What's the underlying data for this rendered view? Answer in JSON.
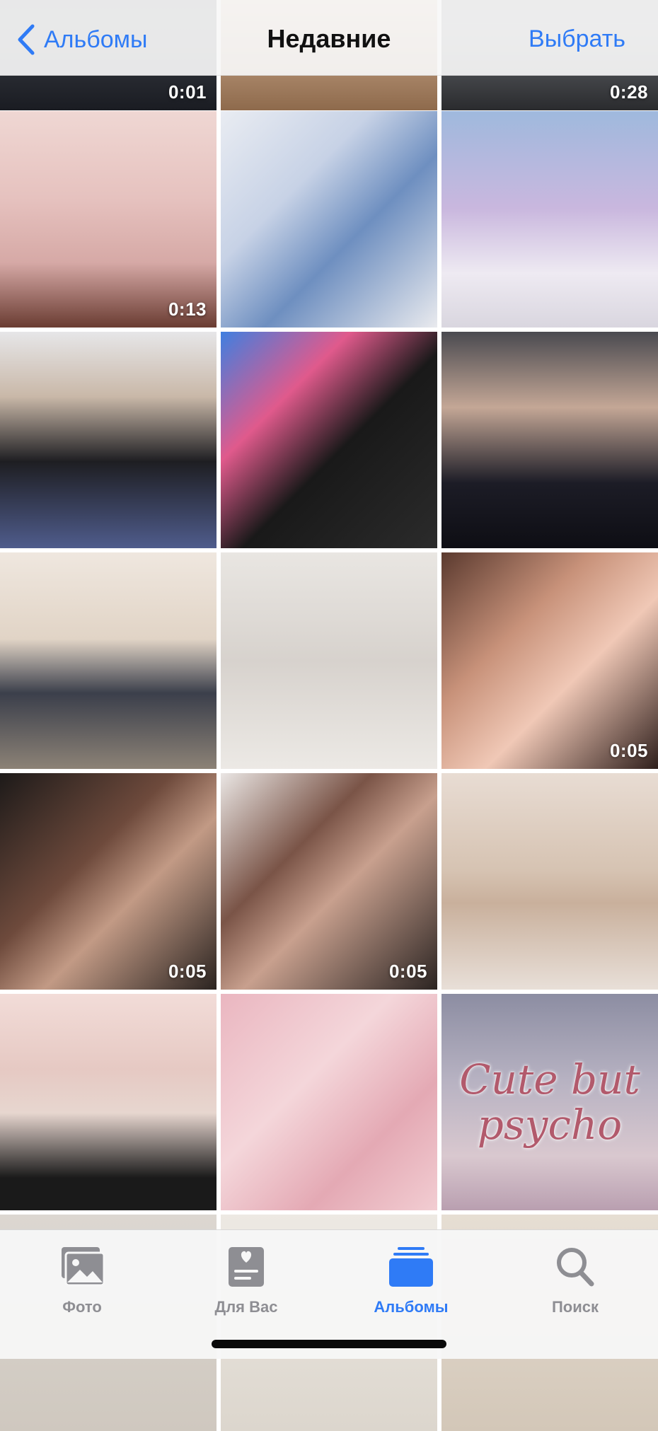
{
  "header": {
    "back_label": "Альбомы",
    "title": "Недавние",
    "select_label": "Выбрать"
  },
  "tiles": [
    {
      "name": "video-partial-1",
      "duration": "0:01",
      "style": "linear-gradient(180deg,#262a33 0%,#3c3f47 60%,#1a1c22 100%)"
    },
    {
      "name": "photo-partial-2",
      "duration": "",
      "style": "linear-gradient(180deg,#b89573 0%,#d9b89b 50%,#8e6a4c 100%)"
    },
    {
      "name": "video-partial-3",
      "duration": "0:28",
      "style": "linear-gradient(180deg,#3a3c40 0%,#6b6e73 60%,#2a2b2e 100%)"
    },
    {
      "name": "video-girl-yellow-shirt",
      "duration": "0:13",
      "style": "linear-gradient(180deg,#efd7d3 0%,#e6c2bf 40%,#d6a9a6 70%,#6a3c32 100%)"
    },
    {
      "name": "photo-ten-denim",
      "duration": "",
      "style": "linear-gradient(135deg,#e9ecf2 0%,#c7d2e6 35%,#6e8fc0 60%,#e9eaee 100%)"
    },
    {
      "name": "photo-boy-lavender-hoodie",
      "duration": "",
      "style": "linear-gradient(180deg,#9fb9dd 0%,#c9b7de 45%,#eeeaf2 75%,#d9d6df 100%)"
    },
    {
      "name": "photo-boy-black-hoodie",
      "duration": "",
      "style": "linear-gradient(180deg,#e6e6e8 0%,#c9b8a8 30%,#1e1e22 60%,#4f5c8c 100%)"
    },
    {
      "name": "photo-boy-black-sweater",
      "duration": "",
      "style": "linear-gradient(135deg,#3f7fe0 0%,#e05a8c 30%,#191919 55%,#2b2b2b 100%)"
    },
    {
      "name": "photo-boy-dark-shirt",
      "duration": "",
      "style": "linear-gradient(180deg,#4a4a50 0%,#c4a796 35%,#1c1c26 70%,#0e0e14 100%)"
    },
    {
      "name": "photo-sitting-on-chest",
      "duration": "",
      "style": "linear-gradient(180deg,#efe7df 0%,#e1d4c6 40%,#3b3f4b 65%,#8c8276 100%)"
    },
    {
      "name": "photo-pencil-portrait",
      "duration": "",
      "style": "linear-gradient(180deg,#e9e6e2 0%,#d7d2cd 50%,#ece9e5 100%)"
    },
    {
      "name": "video-two-girls-selfie",
      "duration": "0:05",
      "style": "linear-gradient(135deg,#5b3a2f 0%,#c8927a 35%,#f0c8b6 60%,#2f1f1c 100%)"
    },
    {
      "name": "video-girl-selfie-1",
      "duration": "0:05",
      "style": "linear-gradient(135deg,#1d1a19 0%,#6e4a3c 40%,#c29a85 60%,#2a2320 100%)"
    },
    {
      "name": "video-girl-selfie-2",
      "duration": "0:05",
      "style": "linear-gradient(135deg,#eae6e4 0%,#7a5447 35%,#c8a08e 55%,#2b2422 100%)"
    },
    {
      "name": "photo-colored-portrait",
      "duration": "",
      "style": "linear-gradient(180deg,#e8dcd3 0%,#d6c3b2 45%,#c9b09c 60%,#e8dfd8 100%)"
    },
    {
      "name": "photo-pink-hair-boy",
      "duration": "",
      "style": "linear-gradient(180deg,#f2dcd8 0%,#e6c9c3 35%,#e7d6cf 55%,#1a1a1a 85%,#1a1a1a 100%)"
    },
    {
      "name": "photo-pink-clouds",
      "duration": "",
      "style": "linear-gradient(135deg,#eab6c0 0%,#f4d6da 40%,#e4a9b4 70%,#f2cdd2 100%)"
    },
    {
      "name": "photo-cute-but-psycho",
      "duration": "",
      "style": "linear-gradient(180deg,#8c8da2 0%,#b7b2c2 40%,#d9c8cf 75%,#b99fb0 100%)",
      "caption": "Cute but psycho"
    },
    {
      "name": "photo-partial-bottom-1",
      "duration": "",
      "style": "linear-gradient(180deg,#dcd7d1 0%,#cfc8bf 100%)"
    },
    {
      "name": "photo-partial-bottom-2",
      "duration": "",
      "style": "linear-gradient(180deg,#ede9e3 0%,#dcd6cd 100%)"
    },
    {
      "name": "photo-partial-bottom-3",
      "duration": "",
      "style": "linear-gradient(180deg,#e6ded3 0%,#d3c7b8 100%)"
    }
  ],
  "tabbar": {
    "tabs": [
      {
        "label": "Фото",
        "icon": "photos-icon"
      },
      {
        "label": "Для Вас",
        "icon": "for-you-icon"
      },
      {
        "label": "Альбомы",
        "icon": "albums-icon",
        "active": true
      },
      {
        "label": "Поиск",
        "icon": "search-icon"
      }
    ]
  },
  "colors": {
    "accent": "#2f7bf6",
    "inactive": "#8e8e93"
  }
}
